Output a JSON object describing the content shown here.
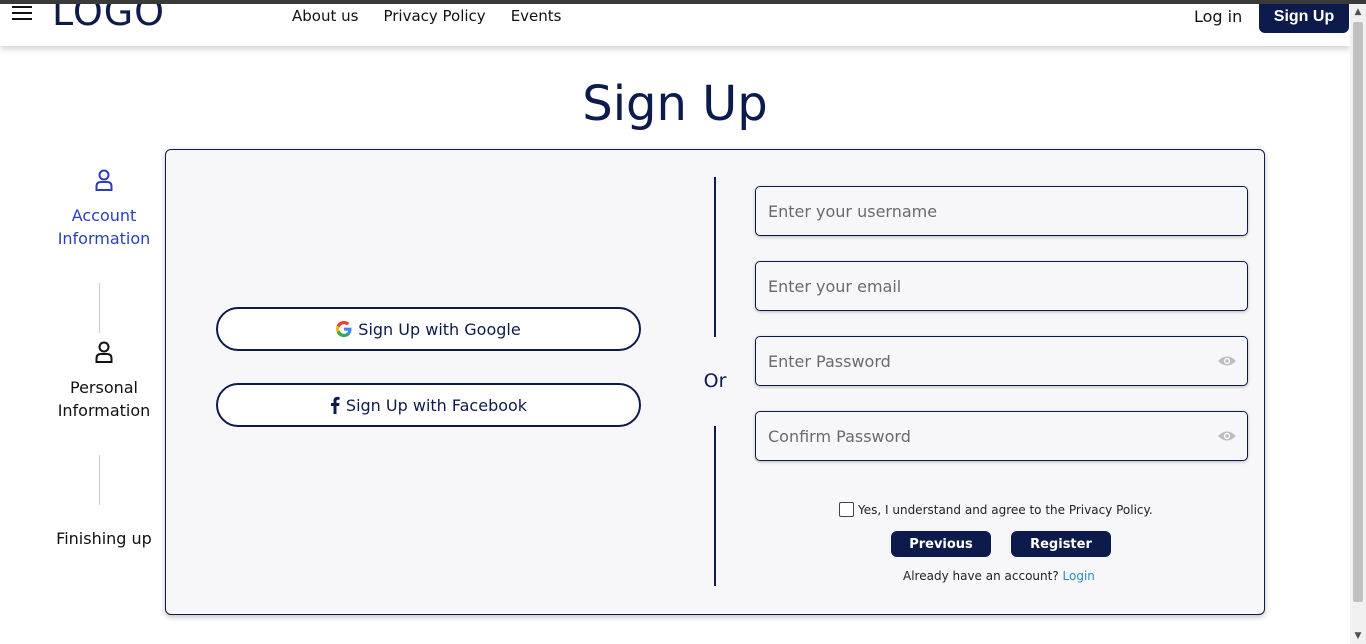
{
  "header": {
    "logo": "LOGO",
    "nav": [
      "About us",
      "Privacy Policy",
      "Events"
    ],
    "login": "Log in",
    "signup": "Sign Up"
  },
  "title": "Sign Up",
  "steps": [
    {
      "label": "Account Information",
      "icon": "user-icon",
      "active": true
    },
    {
      "label": "Personal Information",
      "icon": "user-icon",
      "active": false
    },
    {
      "label": "Finishing up",
      "icon": "",
      "active": false
    }
  ],
  "social": {
    "google": "Sign Up with Google",
    "facebook": "Sign Up with Facebook"
  },
  "or_text": "Or",
  "form": {
    "username_placeholder": "Enter your username",
    "email_placeholder": "Enter your email",
    "password_placeholder": "Enter Password",
    "confirm_placeholder": "Confirm Password",
    "agree": "Yes, I understand and agree to the Privacy Policy.",
    "previous": "Previous",
    "register": "Register",
    "already": "Already have an account?",
    "login_link": "Login"
  },
  "colors": {
    "primary": "#0d1b4c",
    "active_step": "#2a3fbf",
    "link": "#2a8ad0"
  }
}
